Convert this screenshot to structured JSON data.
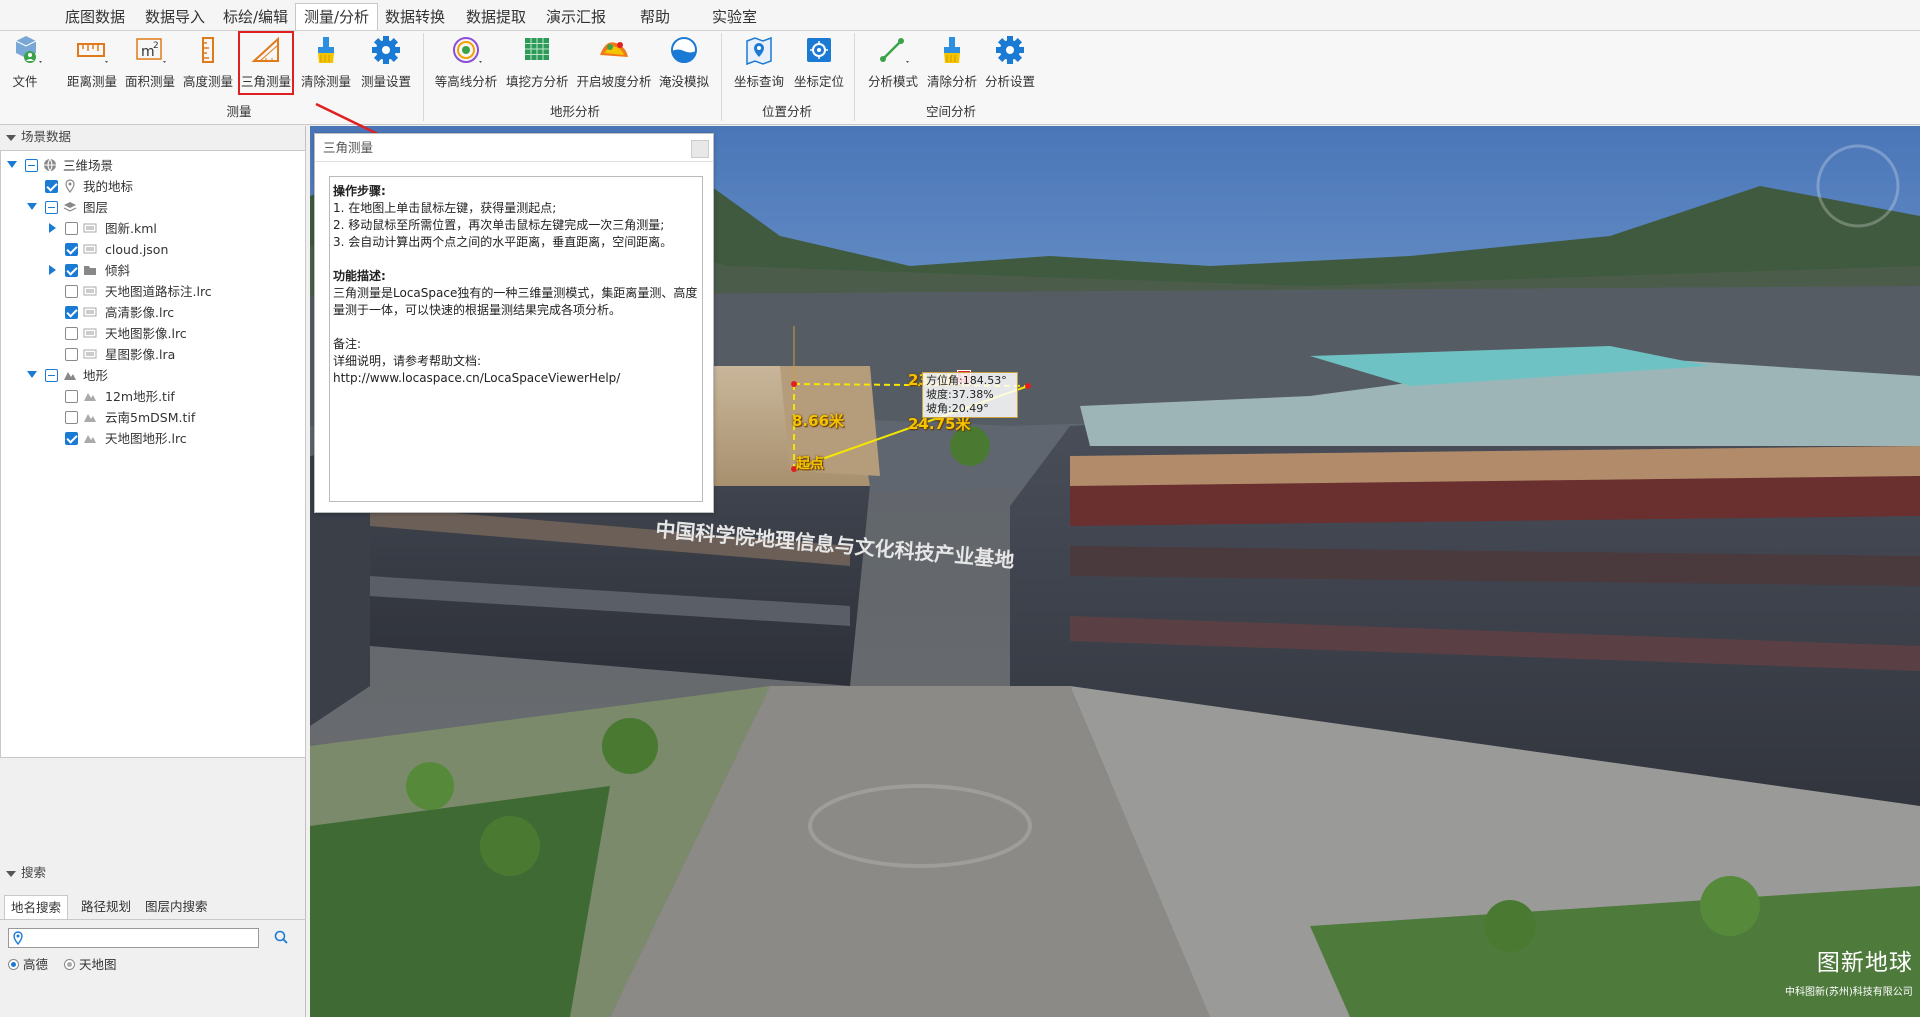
{
  "menubar": {
    "tabs": [
      "底图数据",
      "数据导入",
      "标绘/编辑",
      "测量/分析",
      "数据转换",
      "数据提取",
      "演示汇报",
      "帮助",
      "实验室"
    ],
    "active": "测量/分析"
  },
  "ribbon": {
    "file": {
      "label": "文件"
    },
    "measure": {
      "group_label": "测量",
      "buttons": {
        "distance": "距离测量",
        "area": "面积测量",
        "height": "高度测量",
        "triangle": "三角测量",
        "clear": "清除测量",
        "settings": "测量设置"
      },
      "selected": "三角测量"
    },
    "terrain": {
      "group_label": "地形分析",
      "buttons": {
        "contour": "等高线分析",
        "cutfill": "填挖方分析",
        "slope": "开启坡度分析",
        "flood": "淹没模拟"
      }
    },
    "location": {
      "group_label": "位置分析",
      "buttons": {
        "query": "坐标查询",
        "locate": "坐标定位"
      }
    },
    "spatial": {
      "group_label": "空间分析",
      "buttons": {
        "mode": "分析模式",
        "clear": "清除分析",
        "settings": "分析设置"
      }
    }
  },
  "scene_panel": {
    "header": "场景数据",
    "root": "三维场景",
    "my_places": "我的地标",
    "layers": "图层",
    "layer_items": [
      "图新.kml",
      "cloud.json",
      "倾斜",
      "天地图道路标注.lrc",
      "高清影像.lrc",
      "天地图影像.lrc",
      "星图影像.lra"
    ],
    "terrain": "地形",
    "terrain_items": [
      "12m地形.tif",
      "云南5mDSM.tif",
      "天地图地形.lrc"
    ]
  },
  "search_panel": {
    "header": "搜索",
    "tabs": [
      "地名搜索",
      "路径规划",
      "图层内搜索"
    ],
    "input_value": "",
    "sources": [
      "高德",
      "天地图"
    ],
    "selected_source": "高德"
  },
  "dialog": {
    "title": "三角测量",
    "steps_title": "操作步骤:",
    "steps": [
      "1. 在地图上单击鼠标左键，获得量测起点;",
      "2. 移动鼠标至所需位置，再次单击鼠标左键完成一次三角测量;",
      "3. 会自动计算出两个点之间的水平距离，垂直距离，空间距离。"
    ],
    "desc_title": "功能描述:",
    "desc": "三角测量是LocaSpace独有的一种三维量测模式，集距离量测、高度量测于一体，可以快速的根据量测结果完成各项分析。",
    "note_title": "备注:",
    "note": "详细说明，请参考帮助文档:",
    "link": "http://www.locaspace.cn/LocaSpaceViewerHelp/"
  },
  "measurement": {
    "horizontal": "23.18米",
    "vertical": "8.66米",
    "spatial": "24.75米",
    "start": "起点",
    "info": [
      "方位角:184.53°",
      "坡度:37.38%",
      "坡角:20.49°"
    ]
  },
  "scene": {
    "building_text": "中国科学院地理信息与文化科技产业基地"
  },
  "brand": {
    "name": "图新地球",
    "company": "中科图新(苏州)科技有限公司"
  },
  "colors": {
    "accent": "#1a7ad4",
    "highlight_border": "#e02020",
    "measure_line": "#f5e600"
  }
}
